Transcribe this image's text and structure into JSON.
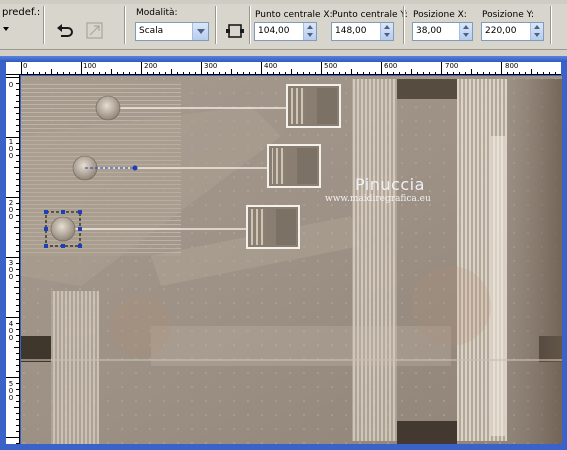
{
  "toolbar": {
    "preset_label": "predef.:",
    "mode_label": "Modalità:",
    "mode_value": "Scala",
    "center_x_label": "Punto centrale X:",
    "center_x_value": "104,00",
    "center_y_label": "Punto centrale Y:",
    "center_y_value": "148,00",
    "pos_x_label": "Posizione X:",
    "pos_x_value": "38,00",
    "pos_y_label": "Posizione Y:",
    "pos_y_value": "220,00",
    "icons": [
      "preset-dropdown-icon",
      "reset-arrow-icon",
      "disabled-transform-icon",
      "edit-mode-icon"
    ]
  },
  "ruler": {
    "horizontal": [
      "0",
      "100",
      "200",
      "300",
      "400",
      "500",
      "600",
      "700",
      "800"
    ],
    "vertical": [
      "0",
      "1\n0\n0",
      "2\n0\n0",
      "3\n0\n0",
      "4\n0\n0",
      "5\n0\n0"
    ]
  },
  "canvas": {
    "watermark_title": "Pinuccia",
    "watermark_url": "www.maidiregrafica.eu",
    "colors": {
      "base": "#9b8f84",
      "light": "#c9beb0",
      "dark": "#3f362c",
      "window_blue": "#3a62c8"
    }
  }
}
